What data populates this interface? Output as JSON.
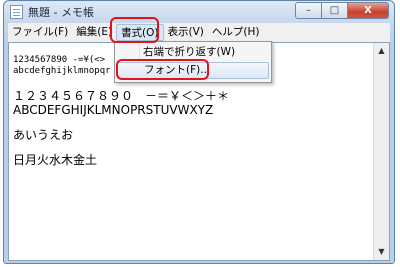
{
  "window": {
    "title": "無題 - メモ帳",
    "min": "–",
    "max": "□",
    "close": "X"
  },
  "menubar": {
    "items": [
      "ファイル(F)",
      "編集(E)",
      "書式(O)",
      "表示(V)",
      "ヘルプ(H)"
    ]
  },
  "format_menu": {
    "items": [
      "右端で折り返す(W)",
      "フォント(F)..."
    ]
  },
  "editor": {
    "lines_small": [
      "1234567890 -=¥(<>",
      "abcdefghijklmnopqr"
    ],
    "lines": [
      "１２３４５６７８９０　－＝￥＜＞＋＊",
      "ABCDEFGHIJKLMNOPRSTUVWXYZ",
      "あいうえお",
      "日月火水木金土"
    ]
  },
  "scrollbar": {
    "up": "▲",
    "down": "▼"
  },
  "colors": {
    "highlight": "#e1141e",
    "title_bg": "#c8d9ee",
    "close_btn": "#c7412e"
  }
}
